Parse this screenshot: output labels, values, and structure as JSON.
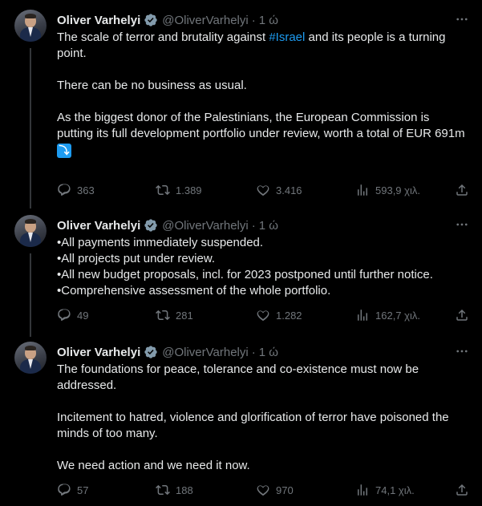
{
  "tweets": [
    {
      "author": "Oliver Varhelyi",
      "handle": "@OliverVarhelyi",
      "dot": "·",
      "time": "1 ώ",
      "lines": {
        "l1a": "The scale of terror and brutality against ",
        "hashtag": "#Israel",
        "l1b": " and its people is a turning point.",
        "l2": "There can be no business as usual.",
        "l3": "As the biggest donor of the Palestinians, the European Commission is putting its full development portfolio under review, worth a total of EUR 691m",
        "emoji": "⤵"
      },
      "stats": {
        "replies": "363",
        "retweets": "1.389",
        "likes": "3.416",
        "views": "593,9 χιλ."
      }
    },
    {
      "author": "Oliver Varhelyi",
      "handle": "@OliverVarhelyi",
      "dot": "·",
      "time": "1 ώ",
      "lines": {
        "l1": "•All payments immediately suspended.",
        "l2": "•All projects put under review.",
        "l3": "•All new budget proposals, incl. for 2023 postponed until further notice.",
        "l4": "•Comprehensive assessment of the whole portfolio."
      },
      "stats": {
        "replies": "49",
        "retweets": "281",
        "likes": "1.282",
        "views": "162,7 χιλ."
      }
    },
    {
      "author": "Oliver Varhelyi",
      "handle": "@OliverVarhelyi",
      "dot": "·",
      "time": "1 ώ",
      "lines": {
        "l1": "The foundations for peace, tolerance and co-existence must now be addressed.",
        "l2": "Incitement to hatred, violence and glorification of terror have poisoned the minds of too many.",
        "l3": "We need action and we need it now."
      },
      "stats": {
        "replies": "57",
        "retweets": "188",
        "likes": "970",
        "views": "74,1 χιλ."
      }
    }
  ],
  "icons": {
    "verified": "verified-badge-icon",
    "more": "more-icon",
    "reply": "reply-icon",
    "retweet": "retweet-icon",
    "like": "like-icon",
    "views": "views-icon",
    "share": "share-icon"
  },
  "colors": {
    "background": "#000000",
    "text": "#e7e9ea",
    "muted": "#71767b",
    "link": "#1d9bf0",
    "thread_line": "#333639"
  }
}
